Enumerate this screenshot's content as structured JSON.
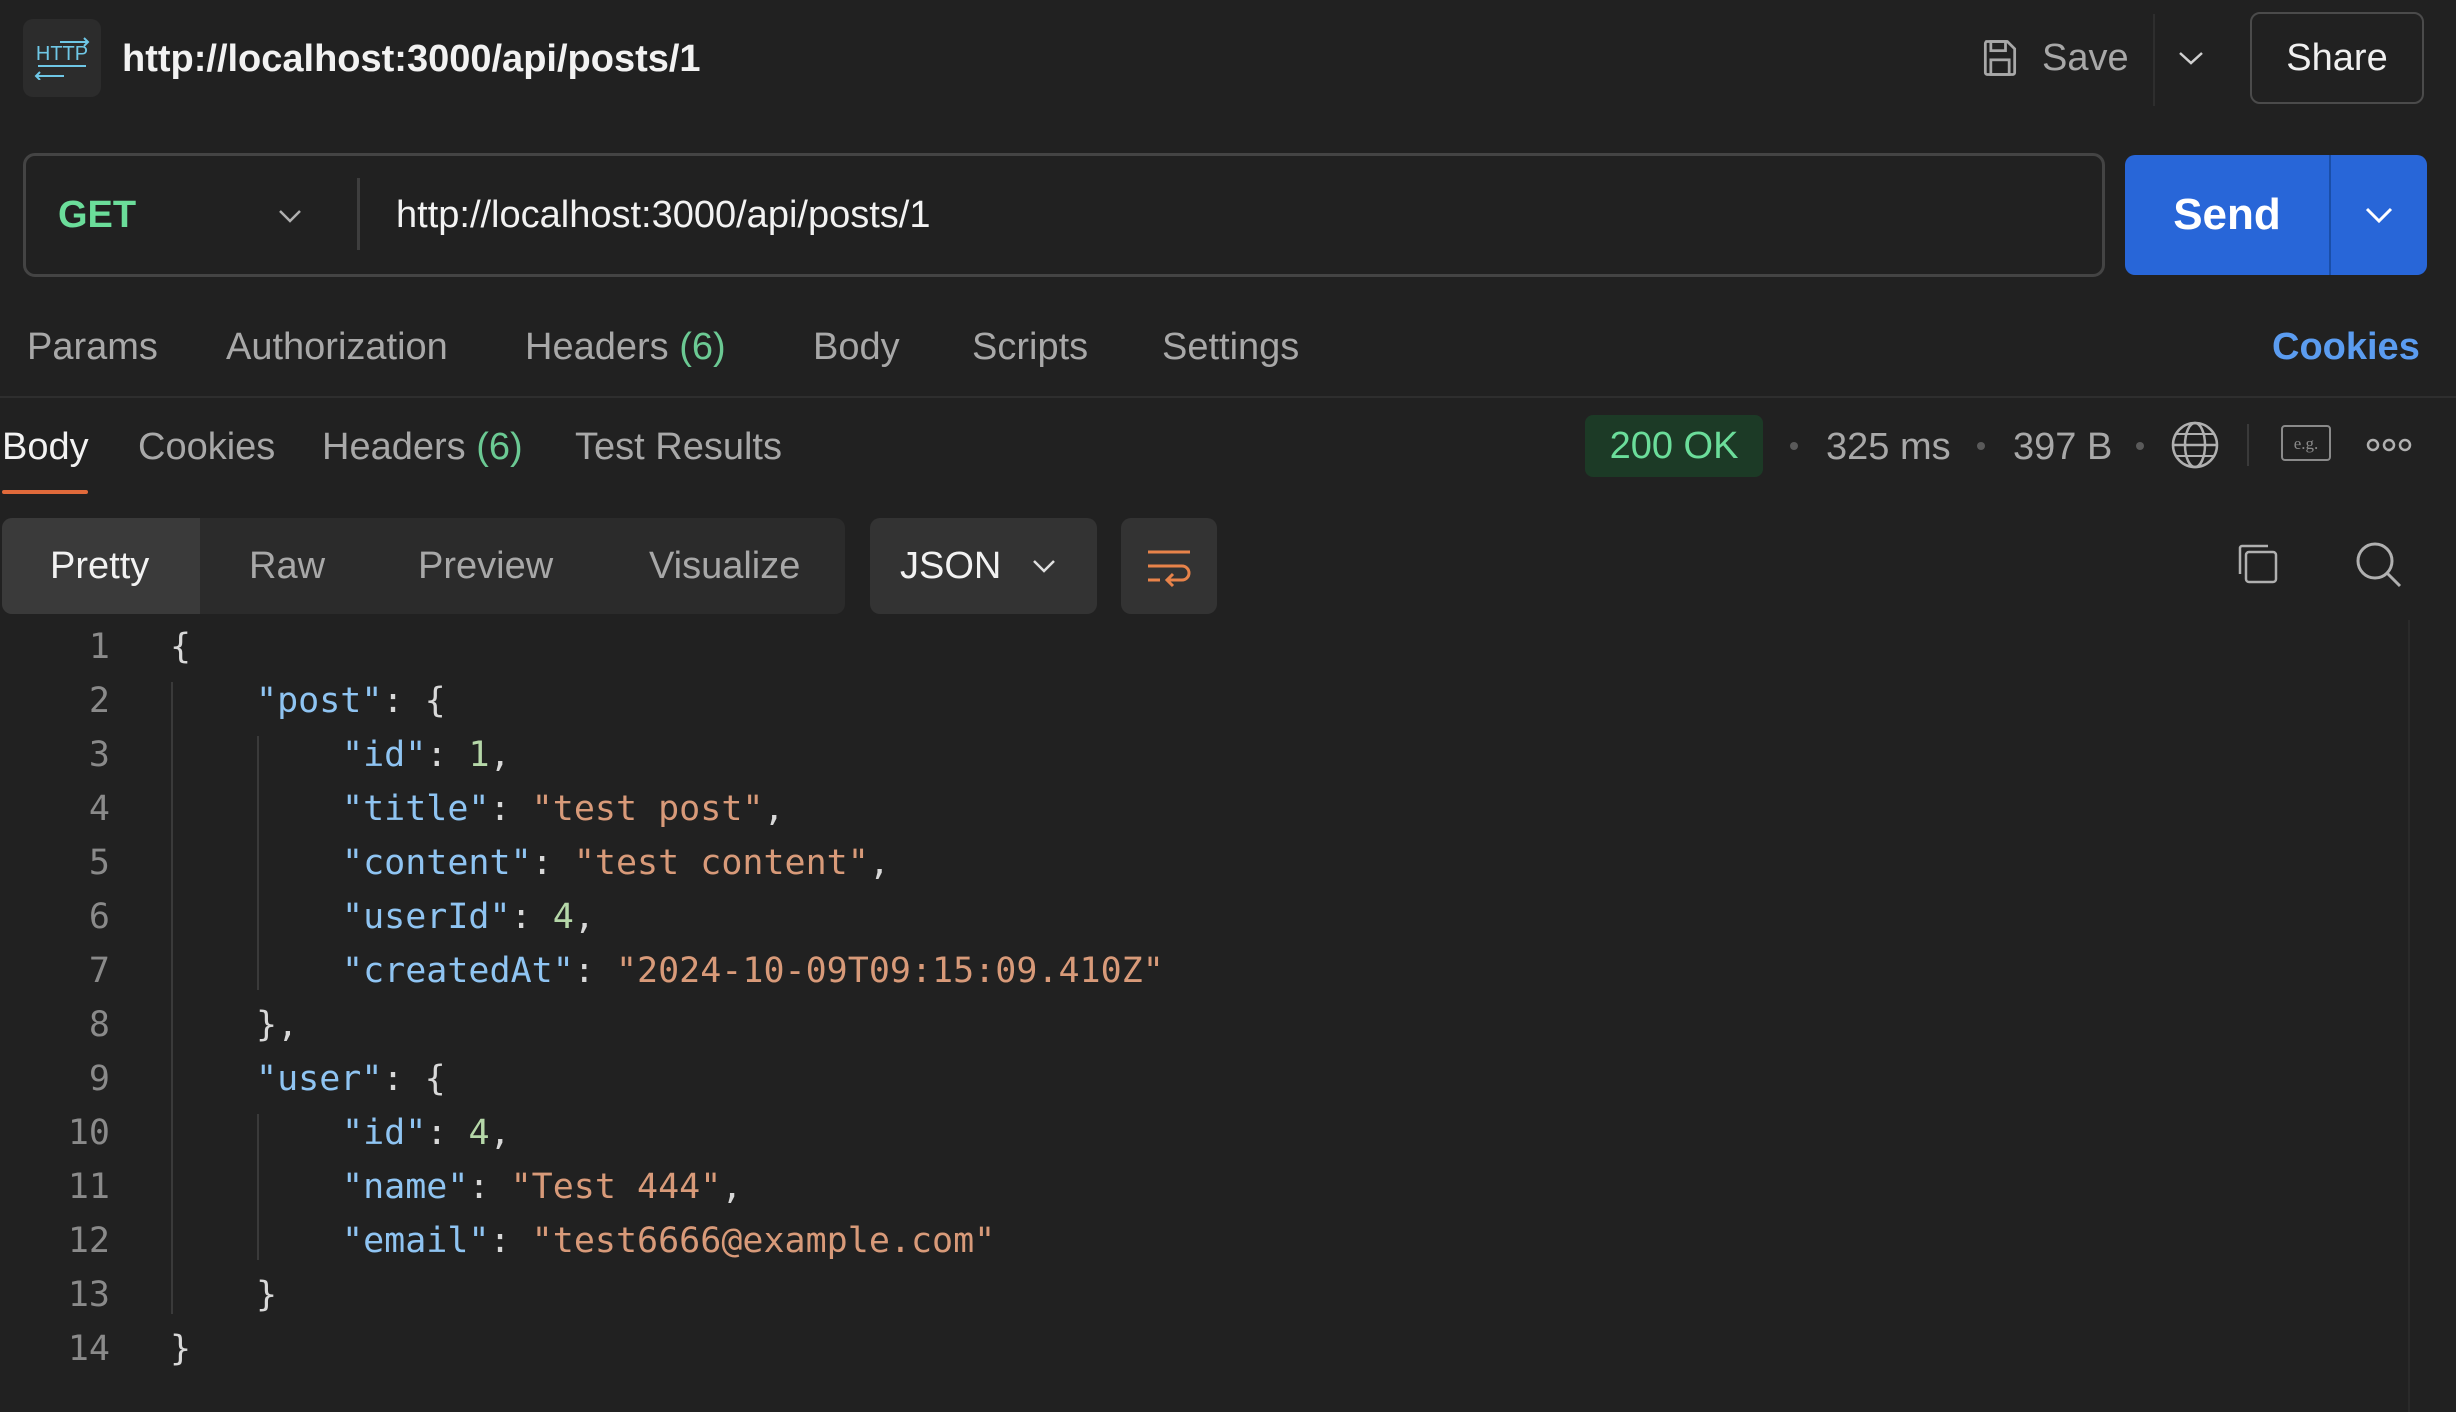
{
  "header": {
    "icon": "http-icon",
    "icon_label": "HTTP",
    "title": "http://localhost:3000/api/posts/1",
    "save_label": "Save",
    "share_label": "Share"
  },
  "request": {
    "method": "GET",
    "url": "http://localhost:3000/api/posts/1",
    "send_label": "Send",
    "tabs": {
      "params": "Params",
      "authorization": "Authorization",
      "headers": "Headers",
      "headers_count": "(6)",
      "body": "Body",
      "scripts": "Scripts",
      "settings": "Settings"
    },
    "cookies_label": "Cookies"
  },
  "response": {
    "tabs": {
      "body": "Body",
      "cookies": "Cookies",
      "headers": "Headers",
      "headers_count": "(6)",
      "test_results": "Test Results"
    },
    "status": "200 OK",
    "time": "325 ms",
    "size": "397 B",
    "example_icon_label": "e.g.",
    "view_modes": [
      "Pretty",
      "Raw",
      "Preview",
      "Visualize"
    ],
    "format": "JSON"
  },
  "colors": {
    "accent": "#2866d8",
    "method_get": "#6bdd9a",
    "status_ok": "#6bdd9a",
    "cookies_link": "#5b9cf0",
    "active_tab_underline": "#e06a3b",
    "json_key": "#8fc4f2",
    "json_string": "#d89a79",
    "json_number": "#b5d7a8"
  },
  "code": {
    "line_numbers": [
      "1",
      "2",
      "3",
      "4",
      "5",
      "6",
      "7",
      "8",
      "9",
      "10",
      "11",
      "12",
      "13",
      "14"
    ],
    "lines": [
      {
        "indent": 0,
        "tokens": [
          {
            "t": "p",
            "v": "{"
          }
        ]
      },
      {
        "indent": 1,
        "tokens": [
          {
            "t": "k",
            "v": "\"post\""
          },
          {
            "t": "p",
            "v": ": {"
          }
        ]
      },
      {
        "indent": 2,
        "tokens": [
          {
            "t": "k",
            "v": "\"id\""
          },
          {
            "t": "p",
            "v": ": "
          },
          {
            "t": "n",
            "v": "1"
          },
          {
            "t": "p",
            "v": ","
          }
        ]
      },
      {
        "indent": 2,
        "tokens": [
          {
            "t": "k",
            "v": "\"title\""
          },
          {
            "t": "p",
            "v": ": "
          },
          {
            "t": "s",
            "v": "\"test post\""
          },
          {
            "t": "p",
            "v": ","
          }
        ]
      },
      {
        "indent": 2,
        "tokens": [
          {
            "t": "k",
            "v": "\"content\""
          },
          {
            "t": "p",
            "v": ": "
          },
          {
            "t": "s",
            "v": "\"test content\""
          },
          {
            "t": "p",
            "v": ","
          }
        ]
      },
      {
        "indent": 2,
        "tokens": [
          {
            "t": "k",
            "v": "\"userId\""
          },
          {
            "t": "p",
            "v": ": "
          },
          {
            "t": "n",
            "v": "4"
          },
          {
            "t": "p",
            "v": ","
          }
        ]
      },
      {
        "indent": 2,
        "tokens": [
          {
            "t": "k",
            "v": "\"createdAt\""
          },
          {
            "t": "p",
            "v": ": "
          },
          {
            "t": "s",
            "v": "\"2024-10-09T09:15:09.410Z\""
          }
        ]
      },
      {
        "indent": 1,
        "tokens": [
          {
            "t": "p",
            "v": "},"
          }
        ]
      },
      {
        "indent": 1,
        "tokens": [
          {
            "t": "k",
            "v": "\"user\""
          },
          {
            "t": "p",
            "v": ": {"
          }
        ]
      },
      {
        "indent": 2,
        "tokens": [
          {
            "t": "k",
            "v": "\"id\""
          },
          {
            "t": "p",
            "v": ": "
          },
          {
            "t": "n",
            "v": "4"
          },
          {
            "t": "p",
            "v": ","
          }
        ]
      },
      {
        "indent": 2,
        "tokens": [
          {
            "t": "k",
            "v": "\"name\""
          },
          {
            "t": "p",
            "v": ": "
          },
          {
            "t": "s",
            "v": "\"Test 444\""
          },
          {
            "t": "p",
            "v": ","
          }
        ]
      },
      {
        "indent": 2,
        "tokens": [
          {
            "t": "k",
            "v": "\"email\""
          },
          {
            "t": "p",
            "v": ": "
          },
          {
            "t": "s",
            "v": "\"test6666@example.com\""
          }
        ]
      },
      {
        "indent": 1,
        "tokens": [
          {
            "t": "p",
            "v": "}"
          }
        ]
      },
      {
        "indent": 0,
        "tokens": [
          {
            "t": "p",
            "v": "}"
          }
        ]
      }
    ]
  }
}
